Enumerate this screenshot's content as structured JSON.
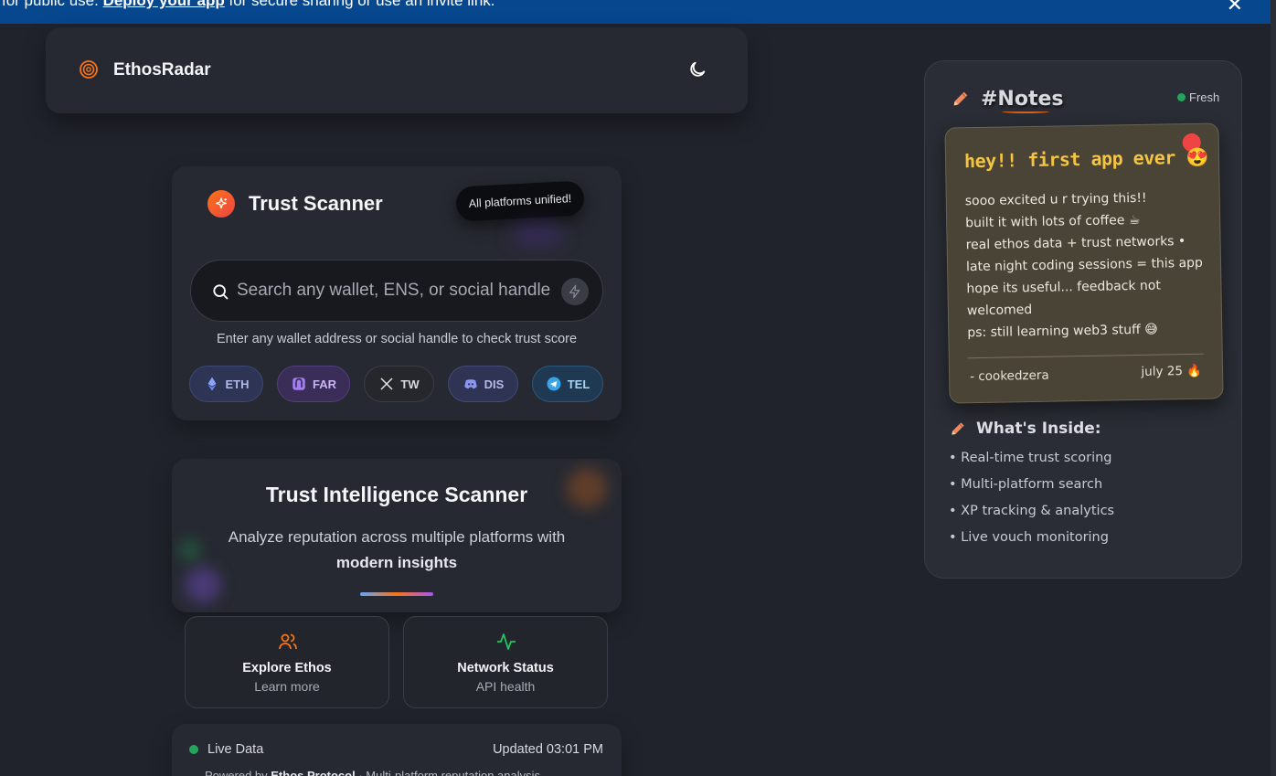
{
  "banner": {
    "prefix": "for public use. ",
    "link": "Deploy your app",
    "suffix": " for secure sharing or use an invite link."
  },
  "header": {
    "app_name": "EthosRadar",
    "logo_icon": "radar-target-icon",
    "theme_icon": "moon-icon"
  },
  "scanner": {
    "title": "Trust Scanner",
    "badge": "All platforms unified!",
    "search_placeholder": "Search any wallet, ENS, or social handle",
    "hint": "Enter any wallet address or social handle to check trust score",
    "platforms": [
      {
        "label": "ETH",
        "icon": "ethereum-icon"
      },
      {
        "label": "FAR",
        "icon": "farcaster-icon"
      },
      {
        "label": "TW",
        "icon": "x-logo-icon"
      },
      {
        "label": "DIS",
        "icon": "discord-icon"
      },
      {
        "label": "TEL",
        "icon": "telegram-icon"
      }
    ]
  },
  "intel": {
    "title": "Trust Intelligence Scanner",
    "desc_part1": "Analyze reputation across multiple platforms with ",
    "desc_bold": "modern insights"
  },
  "mini_cards": [
    {
      "title": "Explore Ethos",
      "subtitle": "Learn more",
      "icon": "users-icon"
    },
    {
      "title": "Network Status",
      "subtitle": "API health",
      "icon": "activity-icon"
    }
  ],
  "status": {
    "live_label": "Live Data",
    "updated": "Updated 03:01 PM",
    "powered_prefix": "Powered by ",
    "powered_bold": "Ethos Protocol",
    "powered_suffix": " · Multi-platform reputation analysis"
  },
  "notes": {
    "title": "#Notes",
    "fresh_label": "Fresh",
    "sticky_title": "hey!! first app ever 😍",
    "sticky_lines": [
      "sooo excited u r trying this!!",
      "built it with lots of coffee ☕",
      "real ethos data + trust networks •",
      "late night coding sessions = this app",
      "hope its useful... feedback not welcomed",
      "ps: still learning web3 stuff 😅"
    ],
    "signature": "- cookedzera",
    "date": "july 25 🔥",
    "inside_title": "What's Inside:",
    "inside_items": [
      "• Real-time trust scoring",
      "• Multi-platform search",
      "• XP tracking & analytics",
      "• Live vouch monitoring"
    ]
  },
  "colors": {
    "background": "#20232b",
    "card": "#262931",
    "banner": "#06478e",
    "accent_orange": "#f97316",
    "live_green": "#22a55a",
    "sticky_title": "#f5c542"
  }
}
